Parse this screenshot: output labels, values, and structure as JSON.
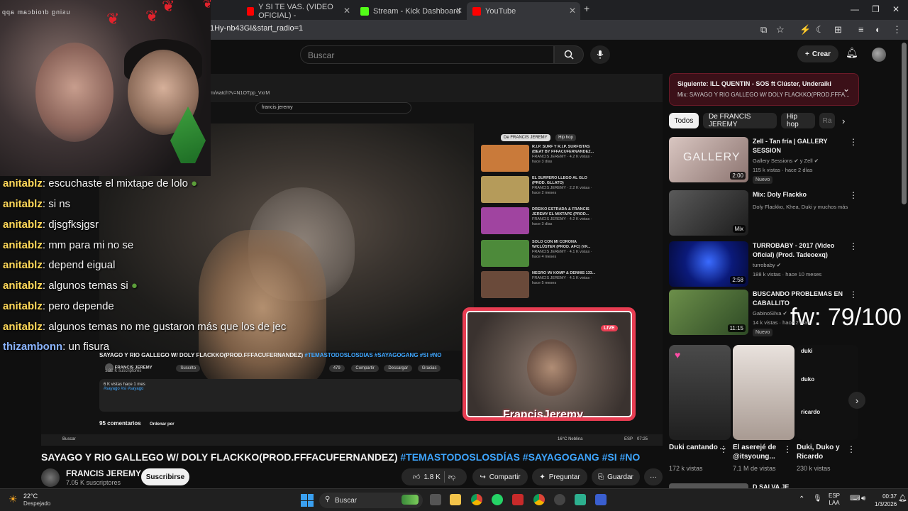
{
  "browser": {
    "tabs": [
      {
        "label": "Y SI TE VAS. (VIDEO OFICIAL) -",
        "favicon_color": "#ff0000"
      },
      {
        "label": "Stream - Kick Dashboard",
        "favicon_color": "#53fc18"
      },
      {
        "label": "YouTube",
        "favicon_color": "#ff0000"
      }
    ],
    "new_tab": "+",
    "url": "1Hy-nb43GI&start_radio=1"
  },
  "youtube": {
    "search_placeholder": "Buscar",
    "create_label": "Crear"
  },
  "overlay": {
    "watermark": "using droidcam app",
    "chat": [
      {
        "user": "anitablz",
        "message": "escuchaste el mixtape de lolo"
      },
      {
        "user": "anitablz",
        "message": "si ns"
      },
      {
        "user": "anitablz",
        "message": "djsgfksjgsr"
      },
      {
        "user": "anitablz",
        "message": "mm para mi no se"
      },
      {
        "user": "anitablz",
        "message": "depend eigual"
      },
      {
        "user": "anitablz",
        "message": "algunos temas si"
      },
      {
        "user": "anitablz",
        "message": "pero depende"
      },
      {
        "user": "anitablz",
        "message": "algunos temas no me gustaron más que los de jec"
      },
      {
        "user": "thizambonn",
        "message": "un fisura"
      }
    ],
    "cam_name": "FrancisJeremy",
    "live_badge": "LIVE",
    "fw_counter": "fw: 79/100"
  },
  "inner": {
    "url": "m/watch?v=N1OTpp_VxrM",
    "search": "francis jeremy",
    "title": "SAYAGO Y RIO GALLEGO W/ DOLY FLACKKO(PROD.FFFACUFERNANDEZ)",
    "tags": "#TEMASTODOSLOSDIAS #SAYAGOGANG #SI #NO",
    "channel": "FRANCIS JEREMY",
    "channel_subs": "1.82 K suscriptores",
    "subscribed": "Suscrito",
    "likes": "479",
    "share": "Compartir",
    "download": "Descargar",
    "thanks": "Gracias",
    "desc_views": "6 K vistas  hace 1 mes",
    "desc_tags": "#sayago #si #sayago",
    "comments": "95 comentarios",
    "sort": "Ordenar por",
    "chips": [
      "De FRANCIS JEREMY",
      "Hip hop"
    ],
    "sidebar": [
      {
        "title": "R.I.P. SURF Y R.I.P. SURFISTAS (BEAT BY FFFACUFERNANDEZ...",
        "meta": "FRANCIS JEREMY · 4.2 K vistas · hace 3 días",
        "color": "#c97a3a"
      },
      {
        "title": "EL SURFERO LLEGO AL GLO (PROD. GLLATO)",
        "meta": "FRANCIS JEREMY · 2.2 K vistas · hace 2 meses",
        "color": "#b59b5a"
      },
      {
        "title": "DREIKO ESTRADA & FRANCIS JEREMY EL MIXTAPE (PROD...",
        "meta": "FRANCIS JEREMY · 4.2 K vistas · hace 3 días",
        "color": "#a044a0"
      },
      {
        "title": "SOLO CON MI CORONA W/CLÚSTER (PROD. AFC) (VF...",
        "meta": "FRANCIS JEREMY · 4.1 K vistas · hace 4 meses",
        "color": "#4d8a3a"
      },
      {
        "title": "NEGRO W/ KOMP & DENNIS 133...",
        "meta": "FRANCIS JEREMY · 4.1 K vistas · hace 5 meses",
        "color": "#6a4a3a"
      }
    ],
    "taskbar_search": "Buscar",
    "weather": "16°C  Neblina",
    "lang": "ESP",
    "time": "07:25"
  },
  "video": {
    "title": "SAYAGO Y RIO GALLEGO W/ DOLY FLACKKO(PROD.FFFACUFERNANDEZ)",
    "tags": "#TEMASTODOSLOSDÍAS #SAYAGOGANG #SI #NO",
    "channel": "FRANCIS JEREMY",
    "subs": "7.05 K suscriptores",
    "subscribe": "Suscribirse",
    "likes": "1.8 K",
    "share": "Compartir",
    "ask": "Preguntar",
    "save": "Guardar",
    "more": "···"
  },
  "right": {
    "up_next_title": "Siguiente: ILL QUENTIN - SOS ft Clúster, Underaiki",
    "up_next_sub": "Mix: SAYAGO Y RIO GALLEGO W/ DOLY FLACKKO(PROD.FFFA...",
    "chips": [
      "Todos",
      "De FRANCIS JEREMY",
      "Hip hop",
      "Ra"
    ],
    "recs": [
      {
        "title": "Zell - Tan fría | GALLERY SESSION",
        "channel": "Gallery Sessions ✔ y Zell ✔",
        "stats": "115 k vistas · hace 2 días",
        "badge": "Nuevo",
        "duration": "2:00",
        "thumb_text": "GALLERY",
        "color": "#c9b8b3"
      },
      {
        "title": "Mix: Doly Flackko",
        "channel": "Doly Flackko, Khea, Duki y muchos más",
        "stats": "",
        "badge": "",
        "duration": "Mix",
        "thumb_text": "",
        "color": "#3a3a3a"
      },
      {
        "title": "TURROBABY - 2017 (Video Oficial) (Prod. Tadeoexq)",
        "channel": "turrobaby ✔",
        "stats": "188 k vistas · hace 10 meses",
        "badge": "",
        "duration": "2:58",
        "thumb_text": "",
        "color": "#0b1a7a"
      },
      {
        "title": "BUSCANDO PROBLEMAS EN CABALLITO",
        "channel": "GabinoSilva ✔",
        "stats": "14 k vistas · hace 2 días",
        "badge": "Nuevo",
        "duration": "11:15",
        "thumb_text": "",
        "color": "#4b6b3a"
      }
    ],
    "shorts": [
      {
        "title": "Duki cantando ...",
        "views": "172 k vistas",
        "color": "#2b2b2b"
      },
      {
        "title": "El aserejé de @itsyoung...",
        "views": "7.1 M de vistas",
        "color": "#d8cfc9"
      },
      {
        "title": "Duki, Duko y Ricardo",
        "views": "230 k vistas",
        "color": "#111111"
      }
    ],
    "shorts_overlay": [
      "duki",
      "duko",
      "ricardo"
    ],
    "next_partial": "D SALVA JE"
  },
  "taskbar": {
    "temp": "22°C",
    "weather": "Despejado",
    "search": "Buscar",
    "lang1": "ESP",
    "lang2": "LAA",
    "time": "00:37",
    "date": "1/3/2026"
  }
}
